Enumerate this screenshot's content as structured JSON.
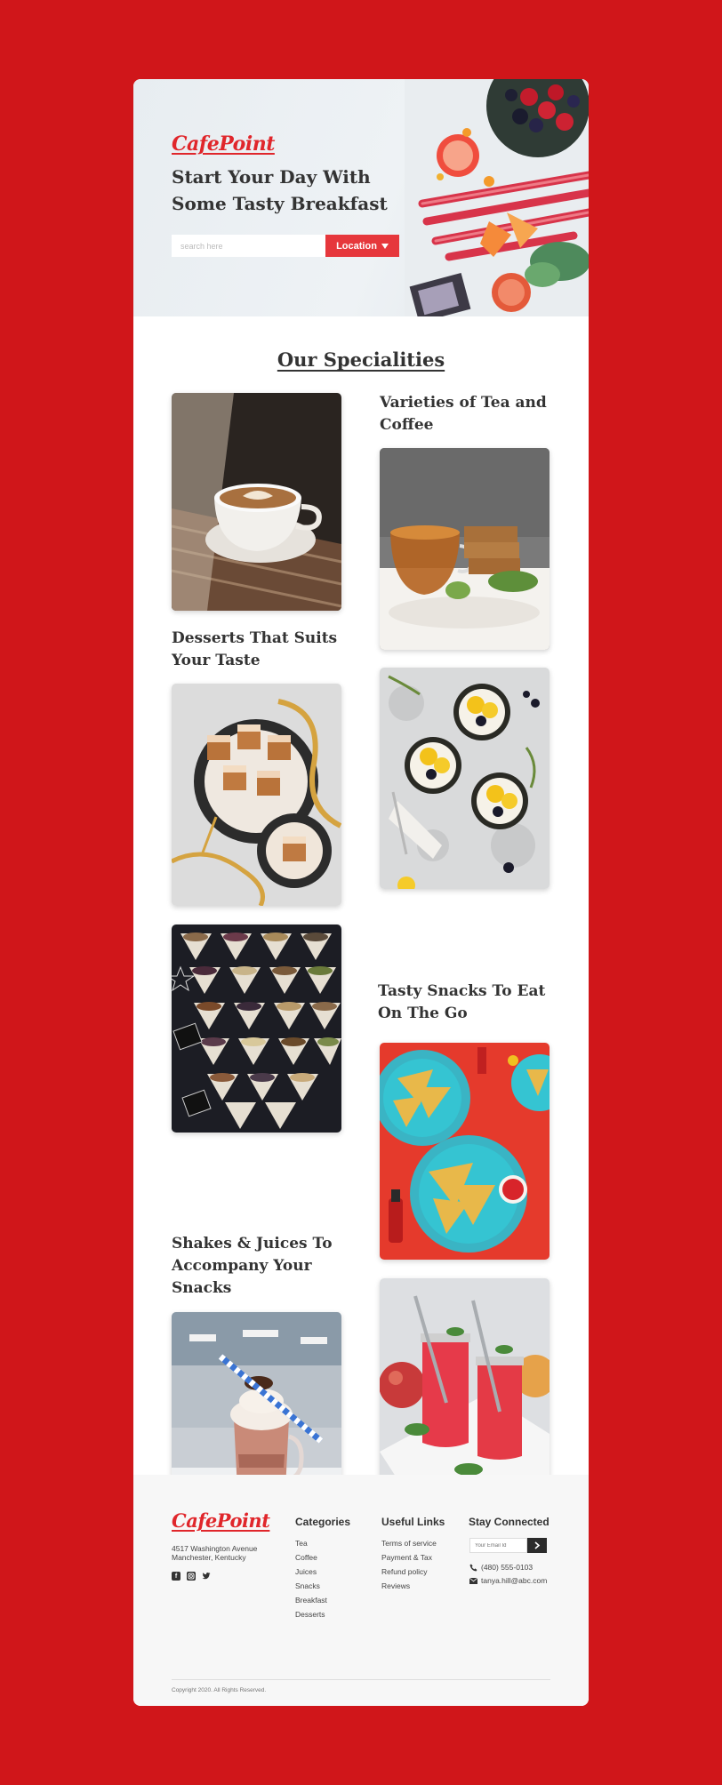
{
  "colors": {
    "page_bg": "#d0161a",
    "accent": "#e6373c",
    "logo": "#e0262b",
    "footer_bg": "#f7f7f7"
  },
  "hero": {
    "logo": "CafePoint",
    "title": "Start Your Day With Some Tasty Breakfast",
    "search_placeholder": "search here",
    "location_label": "Location",
    "location_icon": "caret-down-icon"
  },
  "specialities": {
    "title": "Our Specialities",
    "categories": [
      {
        "title": "Varieties of  Tea and Coffee"
      },
      {
        "title": "Desserts That Suits Your Taste"
      },
      {
        "title": "Tasty Snacks To Eat On The Go"
      },
      {
        "title": "Shakes & Juices To Accompany Your Snacks"
      }
    ]
  },
  "footer": {
    "logo": "CafePoint",
    "address_line1": "4517 Washington Avenue",
    "address_line2": "Manchester, Kentucky",
    "social_icons": [
      "facebook-icon",
      "instagram-icon",
      "twitter-icon"
    ],
    "categories": {
      "heading": "Categories",
      "items": [
        "Tea",
        "Coffee",
        "Juices",
        "Snacks",
        "Breakfast",
        "Desserts"
      ]
    },
    "useful_links": {
      "heading": "Useful Links",
      "items": [
        "Terms of service",
        "Payment & Tax",
        "Refund policy",
        "Reviews"
      ]
    },
    "stay_connected": {
      "heading": "Stay Connected",
      "email_placeholder": "Your Email Id",
      "phone": "(480) 555-0103",
      "email": "tanya.hill@abc.com"
    },
    "copyright": "Copyright 2020. All Rights Reserved."
  }
}
